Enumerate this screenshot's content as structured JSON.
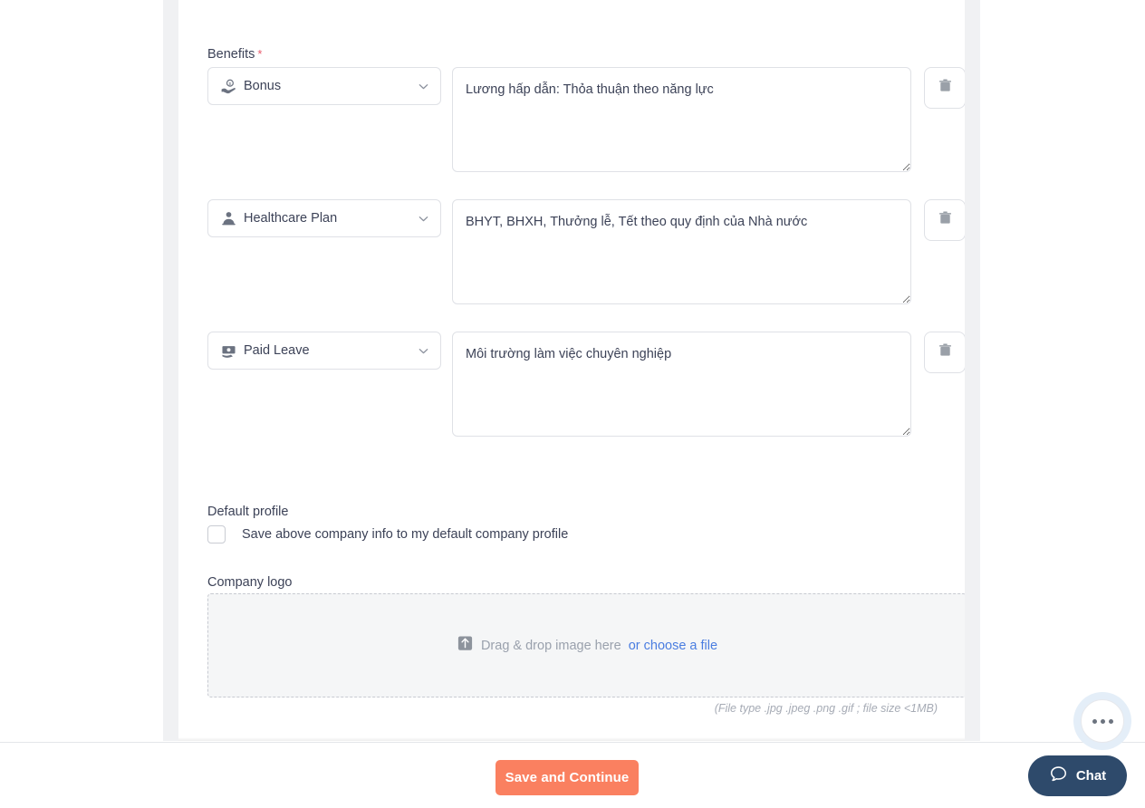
{
  "form": {
    "benefits_label": "Benefits",
    "benefits_required_marker": "*",
    "benefit_rows": [
      {
        "type_icon": "hand-coin-icon",
        "type_label": "Bonus",
        "description": "Lương hấp dẫn: Thỏa thuận theo năng lực",
        "delete_icon": "trash-icon"
      },
      {
        "type_icon": "person-medical-icon",
        "type_label": "Healthcare Plan",
        "description": "BHYT, BHXH, Thưởng lễ, Tết theo quy định của Nhà nước",
        "delete_icon": "trash-icon"
      },
      {
        "type_icon": "banknote-icon",
        "type_label": "Paid Leave",
        "description": "Môi trường làm việc chuyên nghiệp",
        "delete_icon": "trash-icon"
      }
    ],
    "default_profile": {
      "label": "Default profile",
      "checkbox_label": "Save above company info to my default company profile",
      "checked": false
    },
    "company_logo": {
      "label": "Company logo",
      "dropzone_icon": "upload-icon",
      "dropzone_text": "Drag & drop image here",
      "dropzone_link": "or choose a file",
      "file_hint": "(File type .jpg .jpeg .png .gif ; file size <1MB)"
    }
  },
  "action_bar": {
    "primary_button": "Save and Continue"
  },
  "chat_widget": {
    "more_icon": "ellipsis-icon",
    "chat_icon": "speech-bubble-icon",
    "chat_label": "Chat"
  },
  "colors": {
    "primary_button": "#fa8060",
    "link": "#4a7de0",
    "required_star": "#e8596b",
    "chat_pill": "#2e4a6b",
    "panel_gutter": "#f0f1f3",
    "dropzone_bg": "#f5f6f7"
  }
}
